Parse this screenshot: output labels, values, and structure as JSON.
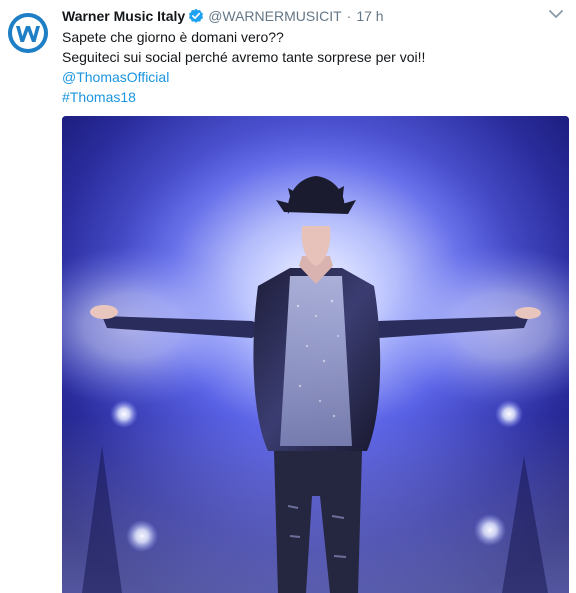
{
  "tweet": {
    "author_name": "Warner Music Italy",
    "handle": "@WARNERMUSICIT",
    "separator": "·",
    "time": "17 h",
    "verified": true,
    "lines": [
      "Sapete che giorno è domani vero??",
      "Seguiteci sui social perché avremo tante sorprese per voi!!"
    ],
    "mention": "@ThomasOfficial",
    "hashtag": "#Thomas18",
    "avatar_logo": "warner-w-logo",
    "menu_icon": "chevron-down-icon",
    "verified_icon": "verified-badge-icon"
  },
  "colors": {
    "link": "#1b95e0",
    "secondary_text": "#657786",
    "avatar_blue": "#1f7fc6",
    "photo_stage_blue": "#3a3fc8"
  }
}
